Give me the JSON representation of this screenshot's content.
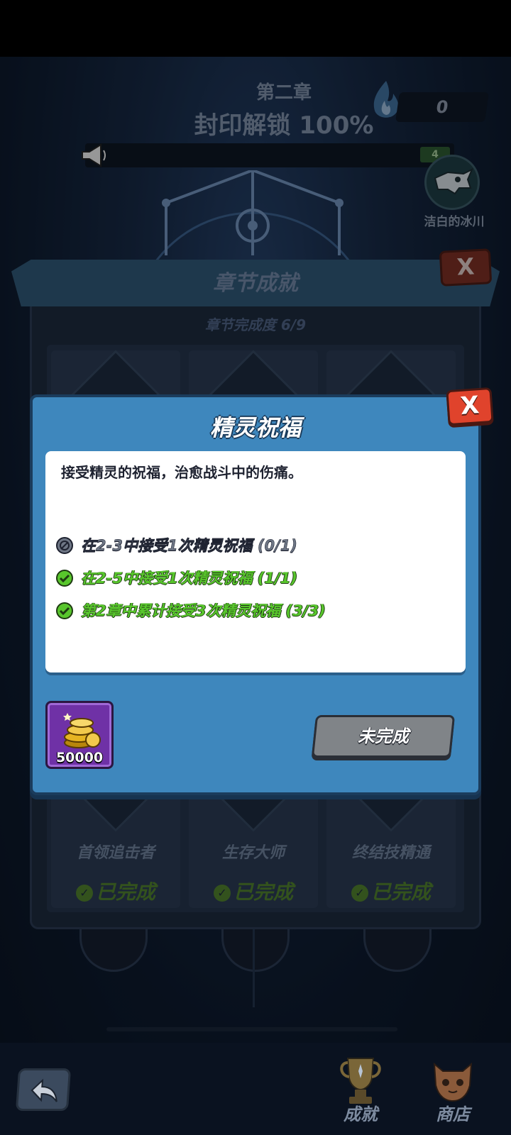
{
  "chapter": {
    "name": "第二章",
    "seal_status": "封印解锁 100%",
    "counter": "0"
  },
  "news": {
    "tag_value": "4"
  },
  "boss": {
    "name": "洁白的冰川"
  },
  "achievements": {
    "title": "章节成就",
    "progress": "章节完成度 6/9",
    "close_label": "X",
    "cards": [
      {
        "name": "首领追击者",
        "status": "已完成"
      },
      {
        "name": "生存大师",
        "status": "已完成"
      },
      {
        "name": "终结技精通",
        "status": "已完成"
      }
    ]
  },
  "modal": {
    "title": "精灵祝福",
    "close_label": "X",
    "description": "接受精灵的祝福，治愈战斗中的伤痛。",
    "tasks": [
      {
        "text": "在2-3中接受1次精灵祝福 (0/1)",
        "state": "pending",
        "icon": "blocked-icon"
      },
      {
        "text": "在2-5中接受1次精灵祝福 (1/1)",
        "state": "done",
        "icon": "check-icon"
      },
      {
        "text": "第2章中累计接受3次精灵祝福 (3/3)",
        "state": "done",
        "icon": "check-icon"
      }
    ],
    "reward": {
      "icon": "gold-coins-icon",
      "amount": "50000"
    },
    "status_button": "未完成"
  },
  "nav": {
    "items": [
      {
        "label": "成就",
        "icon": "trophy-icon"
      },
      {
        "label": "商店",
        "icon": "shop-icon"
      }
    ]
  },
  "colors": {
    "modal_bg": "#3e87bd",
    "close_red": "#e0432c",
    "done_green": "#58c62c",
    "reward_purple": "#6f31a6",
    "status_gray": "#808488"
  }
}
